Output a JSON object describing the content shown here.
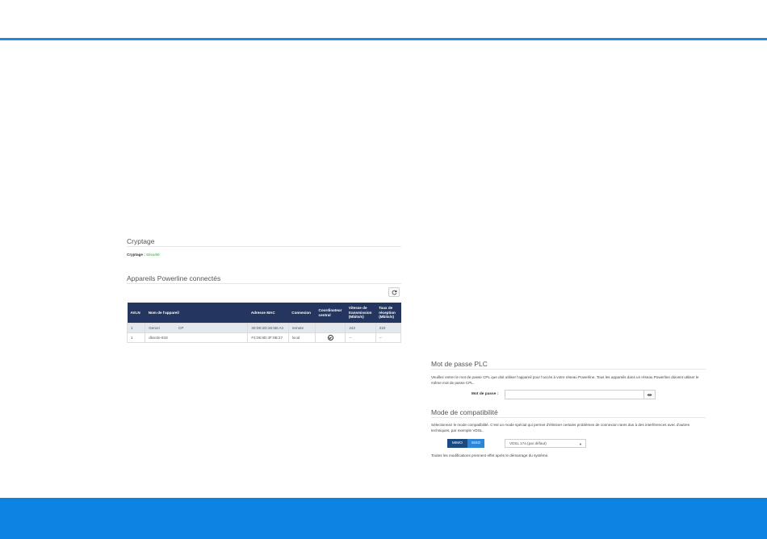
{
  "colors": {
    "accent": "#1e88e5",
    "footer": "#0b84e4",
    "table_header": "#24355f",
    "secure": "#2aa22a",
    "toggle_active": "#1a4b80",
    "toggle_inactive": "#2d86d9"
  },
  "encryption": {
    "title": "Cryptage",
    "label": "Cryptage :",
    "value": "Sécurité"
  },
  "devices": {
    "title": "Appareils Powerline connectés",
    "refresh_icon": "refresh-icon",
    "columns": [
      "AVLN",
      "Nom de l'appareil",
      "Adresse MAC",
      "Connexion",
      "Coordinateur central",
      "Vitesse de transmission (Mbits/s)",
      "Taux de réception (Mbits/s)"
    ],
    "rows": [
      {
        "avln": "1",
        "name": "Gerxei",
        "name_suffix": "CP",
        "mac": "30:D8:2D:26:5B:A3",
        "connection": "remote",
        "coordinator": "",
        "tx": "242",
        "rx": "210"
      },
      {
        "avln": "1",
        "name": "dlxvolo-818",
        "name_suffix": "",
        "mac": "F4:06:8D:4F:8B:27",
        "connection": "local",
        "coordinator": "check-circle-icon",
        "tx": "--",
        "rx": "--"
      }
    ]
  },
  "password": {
    "title": "Mot de passe PLC",
    "description": "Veuillez entrer le mot de passe CPL que doit utiliser l'appareil pour l'accès à votre réseau Powerline. Tous les appareils dans un réseau Powerline doivent utiliser le même mot de passe CPL.",
    "label": "Mot de passe :",
    "value": "",
    "eye_icon": "eye-icon"
  },
  "compat": {
    "title": "Mode de compatibilité",
    "description": "Sélectionnez le mode compatibilité. C'est un mode spécial qui permet d'éliminer certains problèmes de connexion rares dus à des interférences avec d'autres techniques, par exemple VDSL.",
    "toggle": [
      "MIMO",
      "SISO"
    ],
    "selected": "VDSL 17a (par défaut)",
    "note": "Toutes les modifications prennent effet après le démarrage du système."
  }
}
